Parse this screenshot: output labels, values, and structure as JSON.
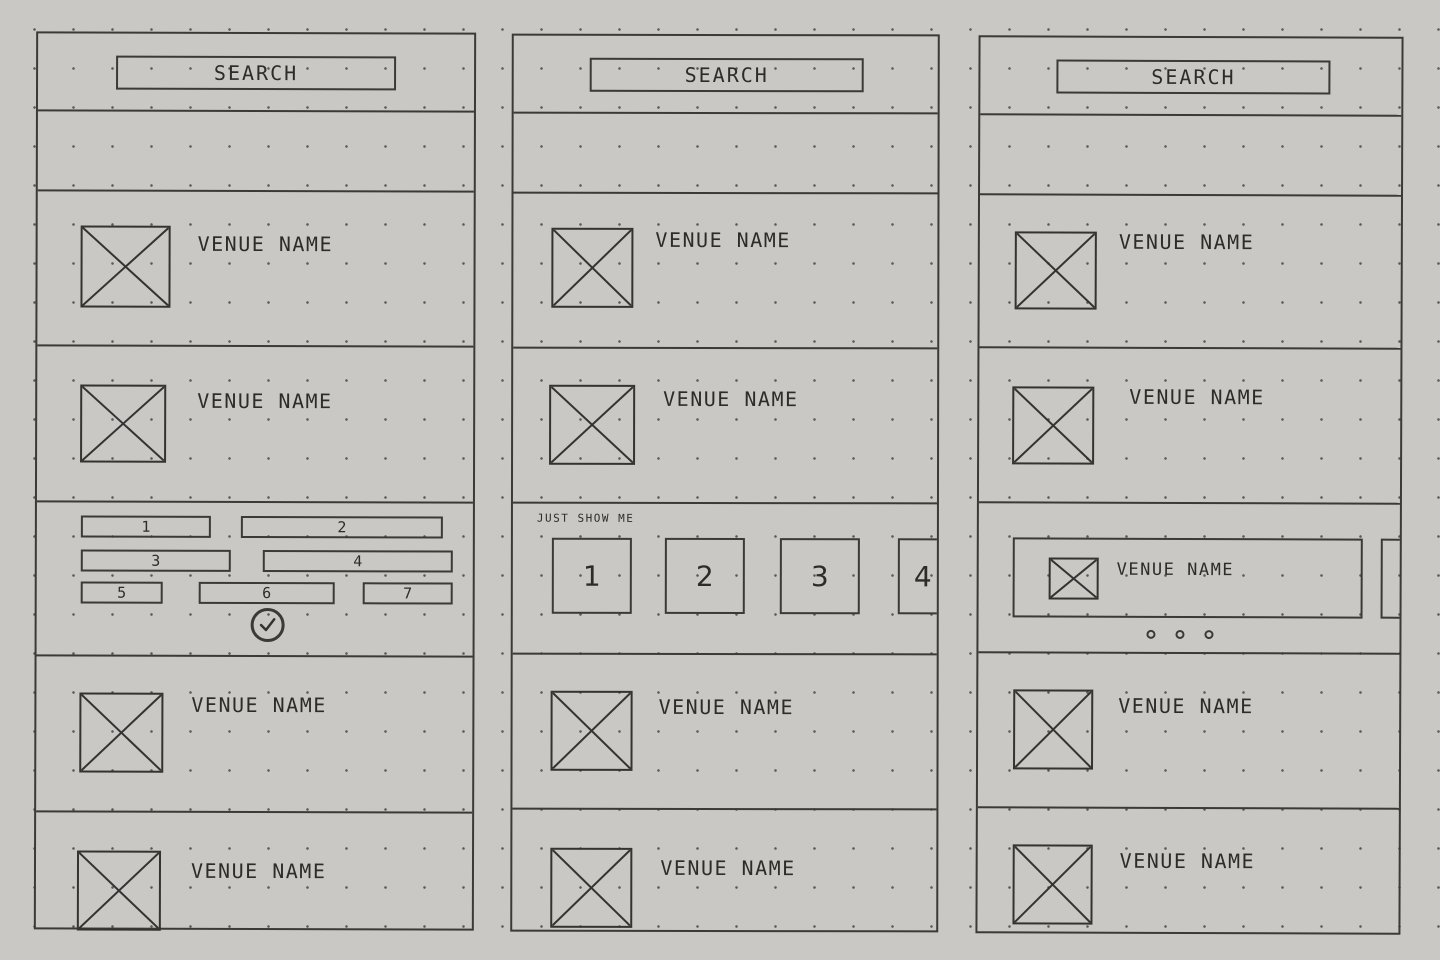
{
  "wireframes": [
    {
      "search_label": "SEARCH",
      "venues_top": [
        "VENUE NAME",
        "VENUE NAME"
      ],
      "filter_chips": [
        "1",
        "2",
        "3",
        "4",
        "5",
        "6",
        "7"
      ],
      "venues_bottom": [
        "VENUE NAME",
        "VENUE NAME"
      ]
    },
    {
      "search_label": "SEARCH",
      "venues_top": [
        "VENUE NAME",
        "VENUE NAME"
      ],
      "filter_label": "JUST SHOW ME",
      "filter_tiles": [
        "1",
        "2",
        "3",
        "4"
      ],
      "venues_bottom": [
        "VENUE NAME",
        "VENUE NAME"
      ]
    },
    {
      "search_label": "SEARCH",
      "venues_top": [
        "VENUE NAME",
        "VENUE NAME"
      ],
      "carousel_card_label": "VENUE NAME",
      "venues_bottom": [
        "VENUE NAME",
        "VENUE NAME"
      ]
    }
  ]
}
